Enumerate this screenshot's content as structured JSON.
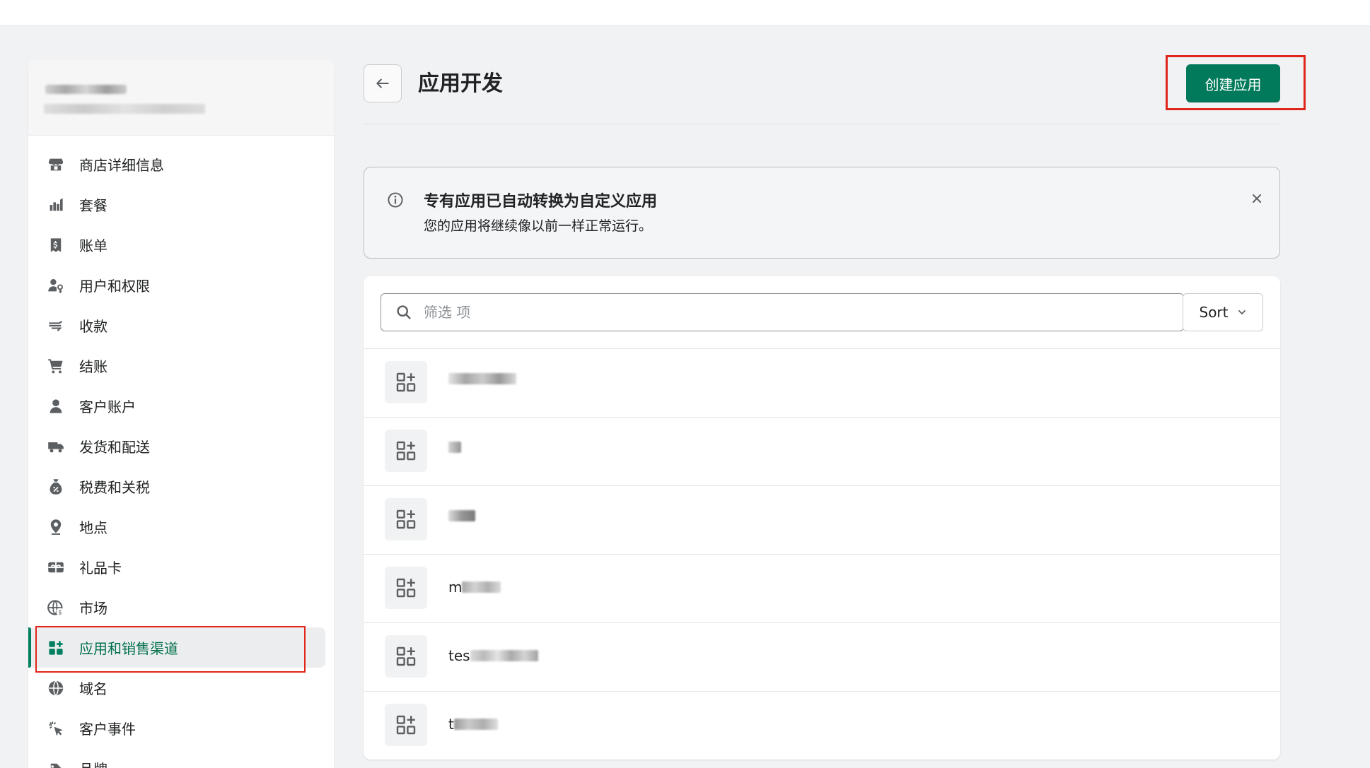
{
  "header": {
    "title": "应用开发",
    "create_button": "创建应用"
  },
  "sidebar": {
    "store_name_blurred": "",
    "items": [
      {
        "label": "商店详细信息",
        "icon": "store-icon"
      },
      {
        "label": "套餐",
        "icon": "plan-icon"
      },
      {
        "label": "账单",
        "icon": "billing-icon"
      },
      {
        "label": "用户和权限",
        "icon": "users-icon"
      },
      {
        "label": "收款",
        "icon": "payments-icon"
      },
      {
        "label": "结账",
        "icon": "cart-icon"
      },
      {
        "label": "客户账户",
        "icon": "person-icon"
      },
      {
        "label": "发货和配送",
        "icon": "truck-icon"
      },
      {
        "label": "税费和关税",
        "icon": "tax-icon"
      },
      {
        "label": "地点",
        "icon": "location-icon"
      },
      {
        "label": "礼品卡",
        "icon": "gift-card-icon"
      },
      {
        "label": "市场",
        "icon": "globe-dollar-icon"
      },
      {
        "label": "应用和销售渠道",
        "icon": "apps-icon",
        "active": true
      },
      {
        "label": "域名",
        "icon": "globe-icon"
      },
      {
        "label": "客户事件",
        "icon": "cursor-click-icon"
      },
      {
        "label": "品牌",
        "icon": "brand-icon"
      }
    ]
  },
  "banner": {
    "title": "专有应用已自动转换为自定义应用",
    "text": "您的应用将继续像以前一样正常运行。"
  },
  "apps_card": {
    "search_placeholder": "筛选 项",
    "sort_label": "Sort",
    "apps": [
      {
        "prefix": ""
      },
      {
        "prefix": ""
      },
      {
        "prefix": ""
      },
      {
        "prefix": "m"
      },
      {
        "prefix": "tes"
      },
      {
        "prefix": "t"
      }
    ]
  },
  "colors": {
    "accent_green": "#007a5a",
    "annotation_red": "#e0261b",
    "page_bg": "#f1f2f4"
  }
}
